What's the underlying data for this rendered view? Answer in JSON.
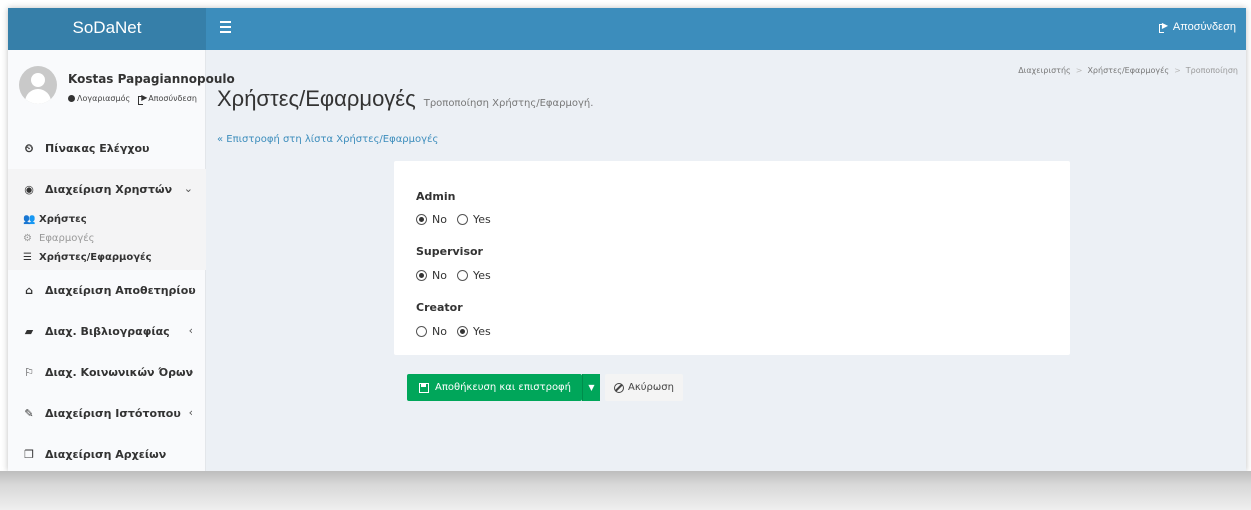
{
  "header": {
    "logo": "SoDaNet",
    "logout": "Αποσύνδεση"
  },
  "user": {
    "name": "Kostas Papagiannopoulo",
    "account_link": "Λογαριασμός",
    "logout_link": "Αποσύνδεση"
  },
  "sidebar": {
    "items": [
      {
        "label": "Πίνακας Ελέγχου",
        "icon": "dashboard-icon"
      },
      {
        "label": "Διαχείριση Χρηστών",
        "icon": "user-circle-icon"
      },
      {
        "label": "Διαχείριση Αποθετηρίου",
        "icon": "bank-icon"
      },
      {
        "label": "Διαχ. Βιβλιογραφίας",
        "icon": "book-icon"
      },
      {
        "label": "Διαχ. Κοινωνικών Όρων",
        "icon": "flag-icon"
      },
      {
        "label": "Διαχείριση Ιστότοπου",
        "icon": "magic-icon"
      },
      {
        "label": "Διαχείριση Αρχείων",
        "icon": "files-icon"
      }
    ],
    "subitems": [
      {
        "label": "Χρήστες",
        "icon": "users-icon"
      },
      {
        "label": "Εφαρμογές",
        "icon": "cogs-icon"
      },
      {
        "label": "Χρήστες/Εφαρμογές",
        "icon": "database-icon"
      }
    ]
  },
  "breadcrumb": [
    "Διαχειριστής",
    "Χρήστες/Εφαρμογές",
    "Τροποποίηση"
  ],
  "page": {
    "title": "Χρήστες/Εφαρμογές",
    "subtitle": "Τροποποίηση Χρήστης/Εφαρμογή.",
    "back_link": "« Επιστροφή στη λίστα Χρήστες/Εφαρμογές"
  },
  "form": {
    "fields": [
      {
        "label": "Admin",
        "options": [
          "No",
          "Yes"
        ],
        "selected": "No"
      },
      {
        "label": "Supervisor",
        "options": [
          "No",
          "Yes"
        ],
        "selected": "No"
      },
      {
        "label": "Creator",
        "options": [
          "No",
          "Yes"
        ],
        "selected": "Yes"
      }
    ]
  },
  "actions": {
    "save": "Αποθήκευση και επιστροφή",
    "cancel": "Ακύρωση"
  },
  "colors": {
    "header": "#3c8dbc",
    "logo_bg": "#367fa9",
    "save_button": "#00a65a",
    "link": "#3c8dbc"
  }
}
